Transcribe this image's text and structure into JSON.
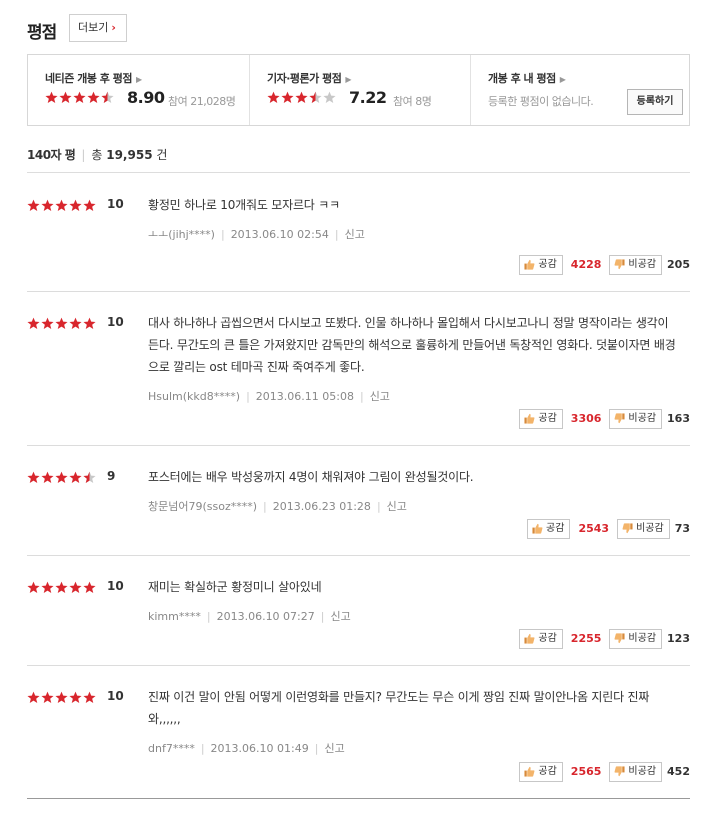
{
  "header": {
    "title": "평점",
    "more_label": "더보기",
    "more_chevron": "›"
  },
  "summary": {
    "netizen": {
      "label": "네티즌 개봉 후 평점",
      "score": "8.90",
      "participants": "참여 21,028명",
      "rating": 4.5
    },
    "critic": {
      "label": "기자·평론가 평점",
      "score": "7.22",
      "participants": "참여 8명",
      "rating": 3.5
    },
    "mine": {
      "label": "개봉 후 내 평점",
      "note": "등록한 평점이 없습니다.",
      "register_label": "등록하기"
    }
  },
  "list_header": {
    "label": "140자 평",
    "total_prefix": "총",
    "total_count": "19,955",
    "total_suffix": "건"
  },
  "vote_labels": {
    "like": "공감",
    "dislike": "비공감"
  },
  "report_label": "신고",
  "colors": {
    "accent": "#d8262d",
    "star_empty": "#c8c8c8"
  },
  "reviews": [
    {
      "score": "10",
      "rating": 5,
      "text": "황정민 하나로 10개줘도 모자르다 ㅋㅋ",
      "author": "ㅗㅗ(jihj****)",
      "date": "2013.06.10 02:54",
      "likes": "4228",
      "dislikes": "205"
    },
    {
      "score": "10",
      "rating": 5,
      "text": "대사 하나하나 곱씹으면서 다시보고 또봤다. 인물 하나하나 몰입해서 다시보고나니 정말 명작이라는 생각이든다. 무간도의 큰 틀은 가져왔지만 감독만의 해석으로 훌륭하게 만들어낸 독창적인 영화다. 덧붙이자면 배경으로 깔리는 ost 테마곡 진짜 죽여주게 좋다.",
      "author": "Hsulm(kkd8****)",
      "date": "2013.06.11 05:08",
      "likes": "3306",
      "dislikes": "163"
    },
    {
      "score": "9",
      "rating": 4.5,
      "text": "포스터에는 배우 박성웅까지 4명이 채워져야 그림이 완성될것이다.",
      "author": "창문넘어79(ssoz****)",
      "date": "2013.06.23 01:28",
      "likes": "2543",
      "dislikes": "73"
    },
    {
      "score": "10",
      "rating": 5,
      "text": "재미는 확실하군 황정미니 살아있네",
      "author": "kimm****",
      "date": "2013.06.10 07:27",
      "likes": "2255",
      "dislikes": "123"
    },
    {
      "score": "10",
      "rating": 5,
      "text": "진짜 이건 말이 안됨 어떻게 이런영화를 만들지? 무간도는 무슨 이게 짱임 진짜 말이안나옴 지린다 진짜 와,,,,,,",
      "author": "dnf7****",
      "date": "2013.06.10 01:49",
      "likes": "2565",
      "dislikes": "452"
    }
  ]
}
